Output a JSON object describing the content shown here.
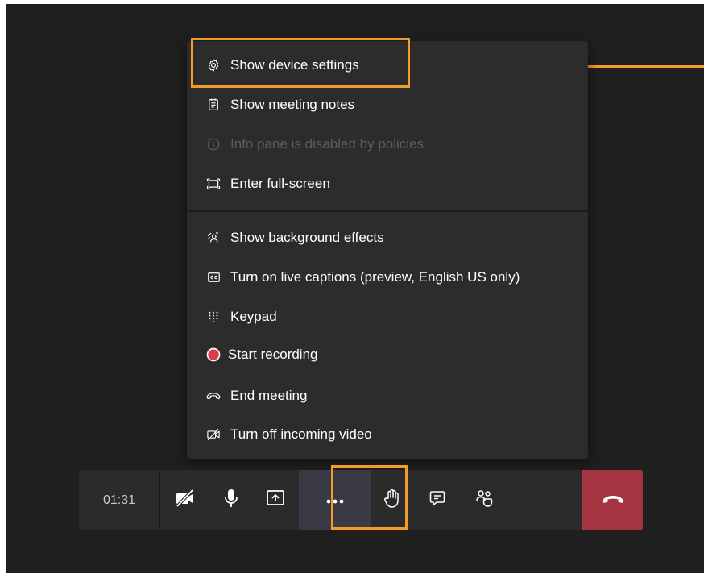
{
  "menu": {
    "items": [
      {
        "label": "Show device settings",
        "icon": "gear-icon",
        "disabled": false
      },
      {
        "label": "Show meeting notes",
        "icon": "notes-icon",
        "disabled": false
      },
      {
        "label": "Info pane is disabled by policies",
        "icon": "info-icon",
        "disabled": true
      },
      {
        "label": "Enter full-screen",
        "icon": "fullscreen-icon",
        "disabled": false
      },
      {
        "label": "Show background effects",
        "icon": "background-effects-icon",
        "disabled": false
      },
      {
        "label": "Turn on live captions (preview, English US only)",
        "icon": "captions-icon",
        "disabled": false
      },
      {
        "label": "Keypad",
        "icon": "keypad-icon",
        "disabled": false
      },
      {
        "label": "Start recording",
        "icon": "record-icon",
        "disabled": false
      },
      {
        "label": "End meeting",
        "icon": "end-meeting-icon",
        "disabled": false
      },
      {
        "label": "Turn off incoming video",
        "icon": "video-off-icon",
        "disabled": false
      }
    ]
  },
  "toolbar": {
    "timer": "01:31",
    "buttons": [
      "camera-off-icon",
      "microphone-icon",
      "share-screen-icon",
      "more-options-icon",
      "raise-hand-icon",
      "chat-icon",
      "participants-icon",
      "hang-up-icon"
    ]
  },
  "colors": {
    "highlight": "#f39c2b",
    "hangup": "#a4343f",
    "record": "#e0394a",
    "background": "#1f1f1f",
    "menu": "#2d2c2c"
  }
}
